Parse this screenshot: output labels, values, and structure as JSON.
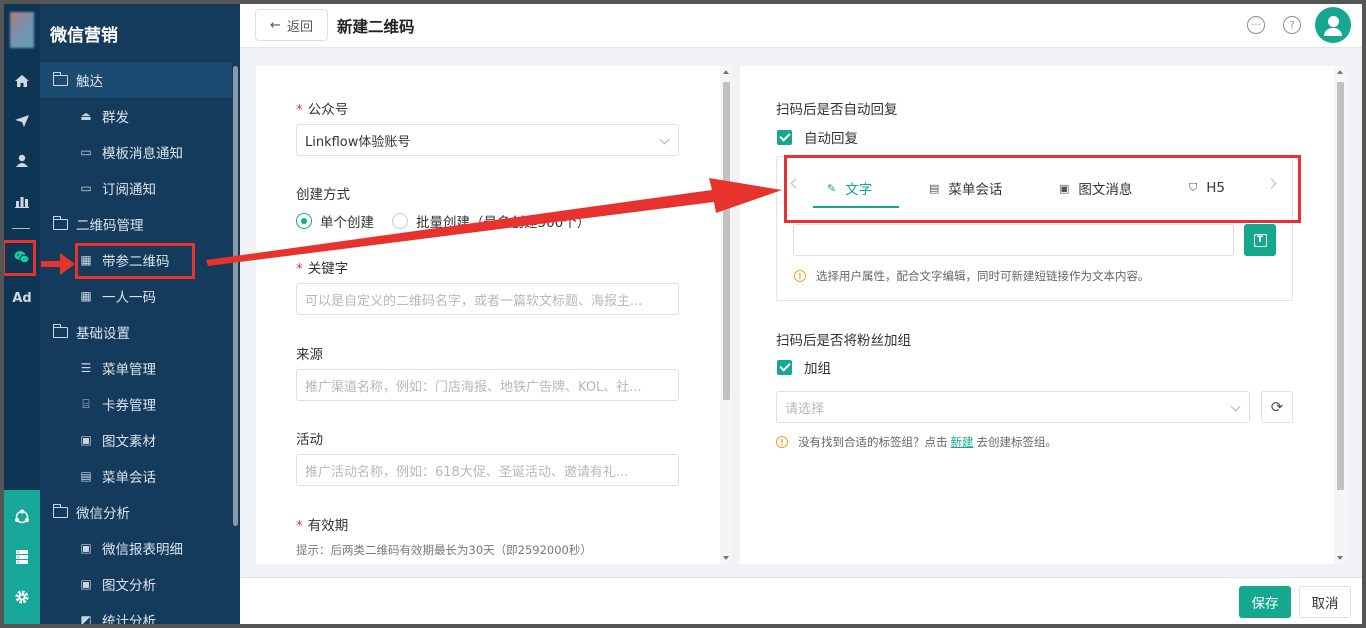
{
  "sidebar": {
    "brand": "微信营销",
    "items": [
      {
        "label": "触达",
        "icon": "folder-icon"
      },
      {
        "label": "群发",
        "icon": "send-icon"
      },
      {
        "label": "模板消息通知",
        "icon": "template-icon"
      },
      {
        "label": "订阅通知",
        "icon": "template-icon"
      },
      {
        "label": "二维码管理",
        "icon": "folder-icon"
      },
      {
        "label": "带参二维码",
        "icon": "qrcode-icon"
      },
      {
        "label": "一人一码",
        "icon": "qrcode-icon"
      },
      {
        "label": "基础设置",
        "icon": "folder-icon"
      },
      {
        "label": "菜单管理",
        "icon": "list-icon"
      },
      {
        "label": "卡券管理",
        "icon": "coupon-icon"
      },
      {
        "label": "图文素材",
        "icon": "article-icon"
      },
      {
        "label": "菜单会话",
        "icon": "chat-icon"
      },
      {
        "label": "微信分析",
        "icon": "folder-icon"
      },
      {
        "label": "微信报表明细",
        "icon": "report-icon"
      },
      {
        "label": "图文分析",
        "icon": "report-icon"
      },
      {
        "label": "统计分析",
        "icon": "chart-icon"
      }
    ],
    "rail_ad": "Ad"
  },
  "header": {
    "back": "返回",
    "title": "新建二维码"
  },
  "form": {
    "account_label": "公众号",
    "account_value": "Linkflow体验账号",
    "mode_label": "创建方式",
    "mode_single": "单个创建",
    "mode_batch": "批量创建（最多创建500个）",
    "keyword_label": "关键字",
    "keyword_placeholder": "可以是自定义的二维码名字，或者一篇软文标题、海报主...",
    "source_label": "来源",
    "source_placeholder": "推广渠道名称，例如：门店海报、地铁广告牌、KOL、社...",
    "activity_label": "活动",
    "activity_placeholder": "推广活动名称，例如：618大促、圣诞活动、邀请有礼...",
    "validity_label": "有效期",
    "validity_hint": "提示：后两类二维码有效期最长为30天（即2592000秒）"
  },
  "right": {
    "auto_reply_title": "扫码后是否自动回复",
    "auto_reply_check": "自动回复",
    "tabs": [
      {
        "label": "文字",
        "icon": "pencil-icon"
      },
      {
        "label": "菜单会话",
        "icon": "chat-icon"
      },
      {
        "label": "图文消息",
        "icon": "article-icon"
      },
      {
        "label": "H5",
        "icon": "html5-icon"
      }
    ],
    "text_hint": "选择用户属性，配合文字编辑，同时可新建短链接作为文本内容。",
    "group_title": "扫码后是否将粉丝加组",
    "group_check": "加组",
    "group_placeholder": "请选择",
    "group_hint_pre": "没有找到合适的标签组？点击",
    "group_hint_link": "新建",
    "group_hint_post": "去创建标签组。"
  },
  "footer": {
    "save": "保存",
    "cancel": "取消"
  },
  "colors": {
    "accent": "#16a78f",
    "sidebar_bg": "#143b5c",
    "rail_bg": "#0f3554",
    "annotation": "#e8322d"
  }
}
